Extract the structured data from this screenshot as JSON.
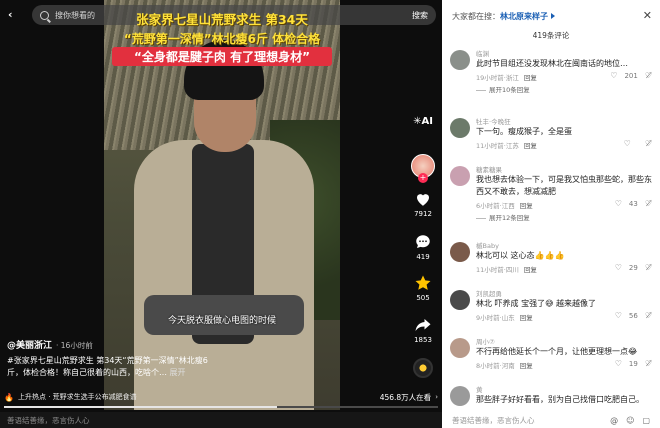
{
  "search": {
    "placeholder": "搜你想看的",
    "button": "搜索"
  },
  "overlay": {
    "line1": "张家界七星山荒野求生 第34天",
    "line2": "“荒野第一深情”林北瘦6斤 体检合格",
    "line3": "“全身都是腱子肉 有了理想身材”",
    "subtitle": "今天脱衣服做心电图的时候"
  },
  "author": {
    "name": "@美丽浙江",
    "time": "· 16小时前"
  },
  "description": {
    "text": "#张家界七星山荒野求生 第34天“荒野第一深情”林北瘦6斤，体检合格！称自己很着的山西，吃啥个…",
    "more": "展开"
  },
  "hot": {
    "title": "上升热点 · 荒野求生选手公布减肥食谱",
    "count": "456.8万人在看"
  },
  "progress_fraction": 0.63,
  "comment_placeholder": "善语结善缘，恶言伤人心",
  "rail": {
    "ai_label": "AI",
    "likes": "7912",
    "comments": "419",
    "favorites": "505",
    "shares": "1853"
  },
  "panel": {
    "search_prefix": "大家都在搜：",
    "search_keyword": "林北原来样子",
    "comment_count": "419条评论",
    "input_placeholder": "善语结善缘，恶言伤人心"
  },
  "comments": [
    {
      "user": "临渊",
      "text": "此时节目组还没发现林北在闽南话的地位…",
      "meta": "19小时前·浙江",
      "reply": "回复",
      "likes": "201",
      "expand": "展开10条回复",
      "color": "#8a8f8a"
    },
    {
      "user": "牡丰·今晚狂",
      "text": "下一句。瘦成猴子，全是蛋",
      "meta": "11小时前·江苏",
      "reply": "回复",
      "likes": "",
      "expand": "",
      "color": "#6c7a6a"
    },
    {
      "user": "糖素糖果",
      "text": "我也想去体验一下，可是我又怕虫那些蛇，那些东西又不敢去，想减减肥",
      "meta": "6小时前·江西",
      "reply": "回复",
      "likes": "43",
      "expand": "展开12条回复",
      "color": "#c9a0b0"
    },
    {
      "user": "槭Baby",
      "text": "林北可以 这心态👍👍👍",
      "meta": "11小时前·四川",
      "reply": "回复",
      "likes": "29",
      "expand": "",
      "color": "#7a5a4a"
    },
    {
      "user": "刘凯超勇",
      "text": "林北 吓养成 宝强了😅 越来越像了",
      "meta": "9小时前·山东",
      "reply": "回复",
      "likes": "56",
      "expand": "",
      "color": "#4a4a4a"
    },
    {
      "user": "周小⑦",
      "text": "不行再给他延长个一个月，让他更理想一点😂",
      "meta": "8小时前·河南",
      "reply": "回复",
      "likes": "19",
      "expand": "",
      "color": "#b89a8a"
    },
    {
      "user": "黄",
      "text": "那些胖子好好看看，别为自己找借口吃肥自己。",
      "meta": "",
      "reply": "",
      "likes": "",
      "expand": "",
      "color": "#9a9a9a"
    }
  ]
}
